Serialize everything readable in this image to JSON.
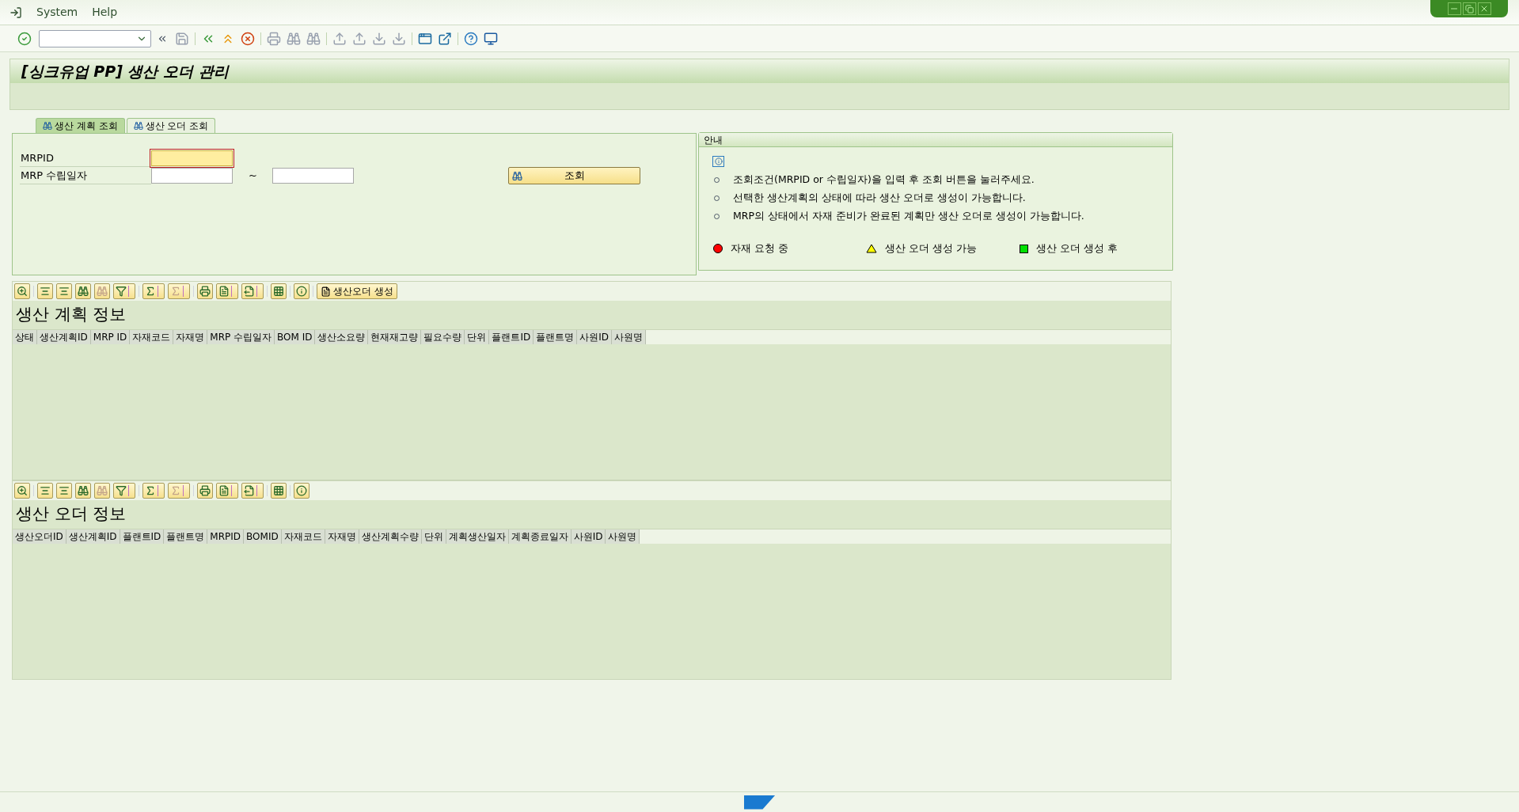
{
  "menu": [
    {
      "label": "System"
    },
    {
      "label": "Help"
    }
  ],
  "title": "[싱크유업 PP] 생산 오더 관리",
  "tabs": [
    {
      "label": "생산 계획 조회",
      "selected": true
    },
    {
      "label": "생산 오더 조회",
      "selected": false
    }
  ],
  "search": {
    "fields": [
      {
        "label": "MRPID",
        "focused": true,
        "range": false
      },
      {
        "label": "MRP 수립일자",
        "focused": false,
        "range": true
      }
    ],
    "range_separator": "~",
    "button": "조회"
  },
  "info": {
    "title": "안내",
    "bullets": [
      "조회조건(MRPID or 수립일자)을 입력 후 조회 버튼을 눌러주세요.",
      "선택한 생산계획의 상태에 따라 생산 오더로 생성이 가능합니다.",
      "MRP의 상태에서 자재 준비가 완료된 계획만 생산 오더로 생성이 가능합니다."
    ],
    "legend": [
      {
        "kind": "circle",
        "color": "#ff0000",
        "label": "자재 요청 중"
      },
      {
        "kind": "triangle",
        "color": "#ffff00",
        "label": "생산 오더 생성 가능"
      },
      {
        "kind": "square",
        "color": "#00e000",
        "label": "생산 오더 생성 후"
      }
    ]
  },
  "grids": [
    {
      "title": "생산 계획 정보",
      "toolbar_button": "생산오더 생성",
      "columns": [
        "상태",
        "생산계획ID",
        "MRP ID",
        "자재코드",
        "자재명",
        "MRP 수립일자",
        "BOM ID",
        "생산소요량",
        "현재재고량",
        "필요수량",
        "단위",
        "플랜트ID",
        "플랜트명",
        "사원ID",
        "사원명"
      ]
    },
    {
      "title": "생산 오더 정보",
      "columns": [
        "생산오더ID",
        "생산계획ID",
        "플랜트ID",
        "플랜트명",
        "MRPID",
        "BOMID",
        "자재코드",
        "자재명",
        "생산계획수량",
        "단위",
        "계획생산일자",
        "계획종료일자",
        "사원ID",
        "사원명"
      ]
    }
  ]
}
